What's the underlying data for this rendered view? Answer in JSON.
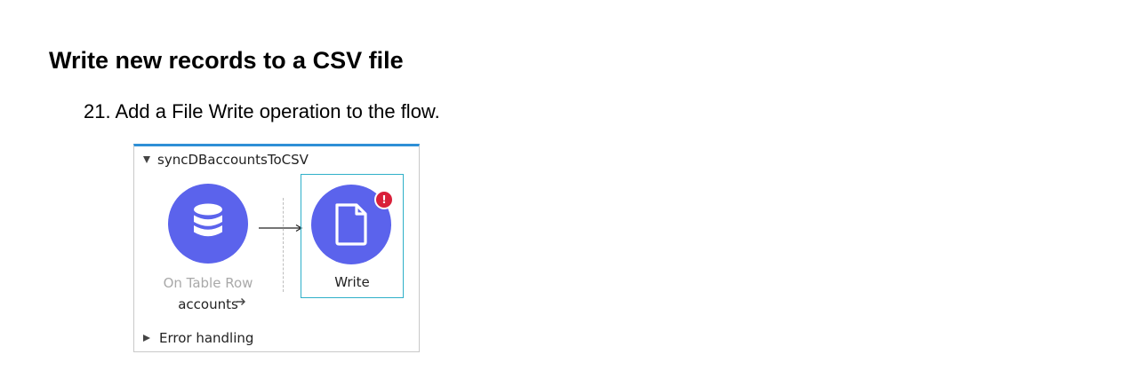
{
  "heading": "Write new records to a CSV file",
  "step": {
    "text": "21. Add a File Write operation to the flow."
  },
  "flow": {
    "name": "syncDBaccountsToCSV",
    "source": {
      "type_label": "On Table Row",
      "name": "accounts",
      "icon": "database-icon"
    },
    "processor": {
      "label": "Write",
      "icon": "file-icon",
      "error_badge": "!"
    },
    "error_handling_label": "Error handling"
  },
  "colors": {
    "accent": "#2e8fd6",
    "node": "#5b63ec",
    "selection": "#2fb0c9",
    "error": "#d9203a"
  }
}
